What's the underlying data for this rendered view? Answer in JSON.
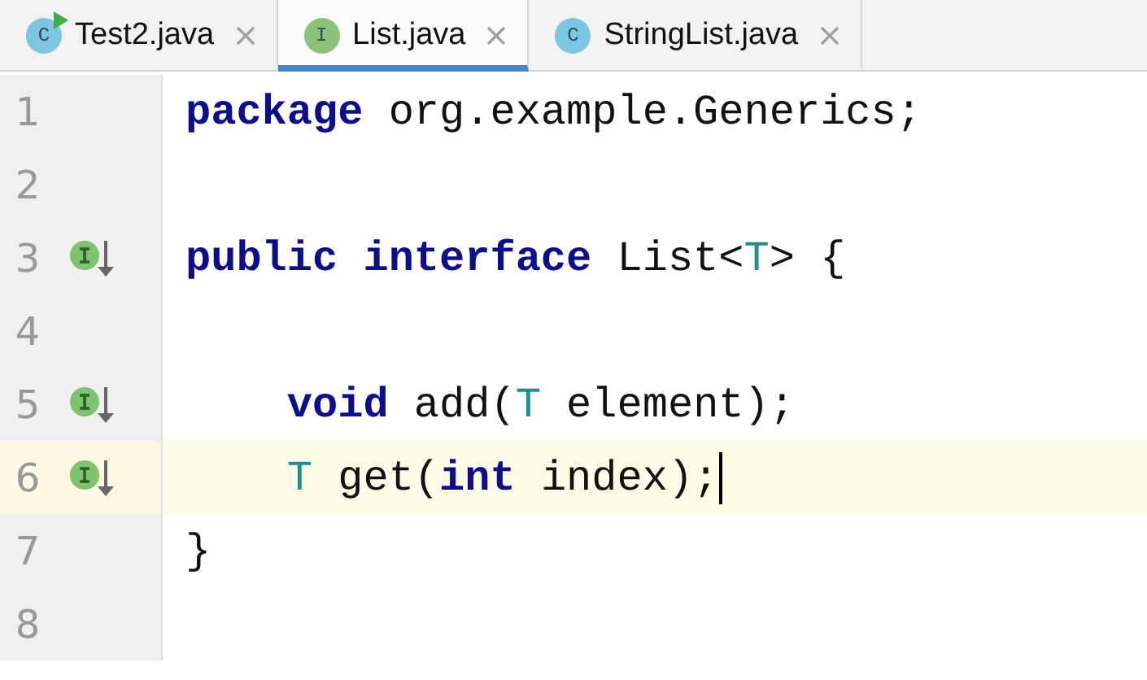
{
  "tabs": [
    {
      "label": "Test2.java",
      "icon_letter": "C",
      "kind": "class",
      "runnable": true,
      "selected": false
    },
    {
      "label": "List.java",
      "icon_letter": "I",
      "kind": "interface",
      "runnable": false,
      "selected": true
    },
    {
      "label": "StringList.java",
      "icon_letter": "C",
      "kind": "class",
      "runnable": false,
      "selected": false
    }
  ],
  "editor": {
    "lines": [
      {
        "number": "1",
        "marker": false,
        "current": false,
        "caret": false,
        "indented": false,
        "tokens": [
          {
            "kind": "keyword",
            "text": "package"
          },
          {
            "kind": "plain",
            "text": " org.example.Generics;"
          }
        ]
      },
      {
        "number": "2",
        "marker": false,
        "current": false,
        "caret": false
      },
      {
        "number": "3",
        "marker": true,
        "current": false,
        "caret": false,
        "indented": false,
        "tokens": [
          {
            "kind": "keyword",
            "text": "public interface"
          },
          {
            "kind": "plain",
            "text": " List<"
          },
          {
            "kind": "type_param",
            "text": "T"
          },
          {
            "kind": "plain",
            "text": "> {"
          }
        ]
      },
      {
        "number": "4",
        "marker": false,
        "current": false,
        "caret": false
      },
      {
        "number": "5",
        "marker": true,
        "current": false,
        "caret": false,
        "indented": true,
        "tokens": [
          {
            "kind": "keyword",
            "text": "void"
          },
          {
            "kind": "plain",
            "text": " add("
          },
          {
            "kind": "type_param",
            "text": "T"
          },
          {
            "kind": "plain",
            "text": " element);"
          }
        ]
      },
      {
        "number": "6",
        "marker": true,
        "current": true,
        "caret": true,
        "indented": true,
        "tokens": [
          {
            "kind": "type_param",
            "text": "T"
          },
          {
            "kind": "plain",
            "text": " get("
          },
          {
            "kind": "keyword",
            "text": "int"
          },
          {
            "kind": "plain",
            "text": " index);"
          }
        ]
      },
      {
        "number": "7",
        "marker": false,
        "current": false,
        "caret": false,
        "indented": false,
        "tokens": [
          {
            "kind": "plain",
            "text": "}"
          }
        ]
      },
      {
        "number": "8",
        "marker": false,
        "current": false,
        "caret": false
      }
    ]
  }
}
